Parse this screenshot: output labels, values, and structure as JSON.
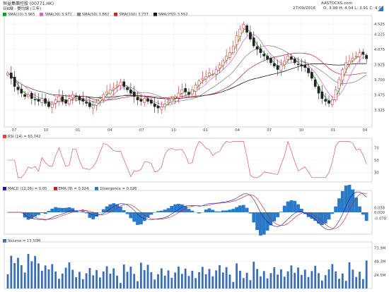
{
  "header": {
    "stock": "恒益集團控股 (00771.HK)",
    "timeframe": "日K線 · 雙均線 (三年)",
    "source": "AASTOCKS.com",
    "datetime": "27/09/2016",
    "ohlc": "O: 3.98  H: 4.04  L: 3.91  C: 4.01"
  },
  "colors": {
    "up": "#d02020",
    "down": "#222222",
    "sma10": "#00a000",
    "sma20": "#d060d0",
    "sma50": "#808080",
    "sma100": "#c02020",
    "sma250": "#000000",
    "rsi": "#e04040",
    "macd": "#1a1aa0",
    "ema": "#c02020",
    "hist": "#2a7ac8",
    "volume": "#3a6fb8",
    "grid": "#d6d6d6"
  },
  "chart_data": [
    {
      "type": "candlestick",
      "panel": "price",
      "legend": [
        {
          "name": "SMA(10)",
          "value": "3.965"
        },
        {
          "name": "SMA(20)",
          "value": "3.972"
        },
        {
          "name": "SMA(50)",
          "value": "3.882"
        },
        {
          "name": "SMA(100)",
          "value": "3.737"
        },
        {
          "name": "SMA(250)",
          "value": "3.552"
        }
      ],
      "ylim": [
        3.0,
        4.65
      ],
      "yticks": [
        3.25,
        3.475,
        3.7,
        3.925,
        4.15,
        4.375,
        4.525
      ],
      "ytick_labels": [
        "3.325",
        "3.475",
        "3.700",
        "3.925",
        "4.075",
        "4.225",
        "4.525"
      ],
      "xticks": [
        "07",
        "10",
        "01",
        "04",
        "07",
        "10",
        "01",
        "04",
        "07",
        "10",
        "01",
        "04"
      ],
      "close_series": [
        3.8,
        3.72,
        3.6,
        3.55,
        3.5,
        3.45,
        3.48,
        3.42,
        3.4,
        3.38,
        3.42,
        3.35,
        3.3,
        3.34,
        3.4,
        3.45,
        3.38,
        3.35,
        3.42,
        3.48,
        3.45,
        3.4,
        3.38,
        3.35,
        3.3,
        3.32,
        3.36,
        3.42,
        3.48,
        3.52,
        3.55,
        3.58,
        3.62,
        3.66,
        3.6,
        3.55,
        3.5,
        3.45,
        3.4,
        3.38,
        3.42,
        3.38,
        3.35,
        3.3,
        3.28,
        3.3,
        3.34,
        3.38,
        3.42,
        3.45,
        3.5,
        3.55,
        3.52,
        3.48,
        3.55,
        3.62,
        3.68,
        3.72,
        3.75,
        3.8,
        3.78,
        3.85,
        3.92,
        3.98,
        4.05,
        4.1,
        4.2,
        4.35,
        4.45,
        4.52,
        4.4,
        4.3,
        4.2,
        4.15,
        4.1,
        4.05,
        4.0,
        3.95,
        3.9,
        3.85,
        3.92,
        3.98,
        4.05,
        4.0,
        3.95,
        3.92,
        3.9,
        3.88,
        3.8,
        3.72,
        3.6,
        3.5,
        3.42,
        3.38,
        3.35,
        3.4,
        3.55,
        3.7,
        3.85,
        3.95,
        3.98,
        4.02,
        4.05,
        4.1,
        4.08,
        4.01
      ]
    },
    {
      "type": "line",
      "panel": "rsi",
      "legend": [
        {
          "name": "RSI (14)",
          "value": "= 63.742"
        }
      ],
      "ylim": [
        15,
        85
      ],
      "yticks": [
        30,
        50,
        70
      ],
      "ytick_labels": [
        "30",
        "50",
        "70"
      ]
    },
    {
      "type": "line+bar",
      "panel": "macd",
      "legend": [
        {
          "name": "MACD (12,26)",
          "value": "= 0.05"
        },
        {
          "name": "EMA (9)",
          "value": "= 0.024"
        },
        {
          "name": "Divergence",
          "value": "= 0.026"
        }
      ],
      "ytick_labels": [
        "0.058",
        "0.000",
        "-0.078"
      ]
    },
    {
      "type": "bar",
      "panel": "volume",
      "legend": [
        {
          "name": "Volume",
          "value": "= 13.50M"
        }
      ],
      "ylim": [
        0,
        85
      ],
      "yticks": [
        24.5,
        49.3,
        73.9
      ],
      "ytick_labels": [
        "24.5M",
        "49.3M",
        "73.9M"
      ]
    }
  ]
}
